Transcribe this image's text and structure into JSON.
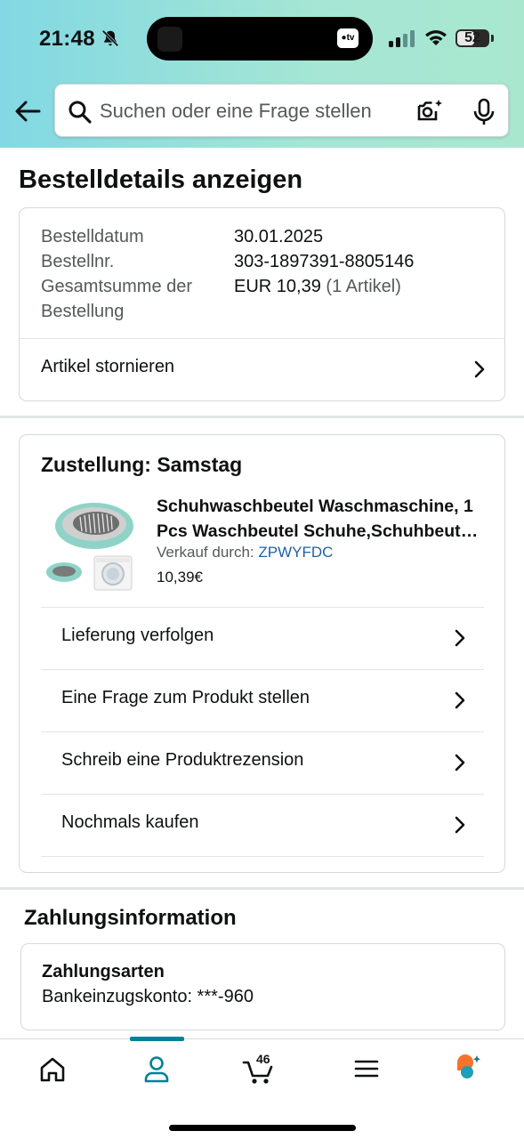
{
  "status_bar": {
    "time": "21:48",
    "battery": "52"
  },
  "search": {
    "placeholder": "Suchen oder eine Frage stellen"
  },
  "page": {
    "title": "Bestelldetails anzeigen"
  },
  "order_summary": {
    "date_label": "Bestelldatum",
    "date_value": "30.01.2025",
    "number_label": "Bestellnr.",
    "number_value": "303-1897391-8805146",
    "total_label_1": "Gesamtsumme der",
    "total_label_2": "Bestellung",
    "total_value": "EUR 10,39",
    "total_items": "(1 Artikel)",
    "cancel_label": "Artikel stornieren"
  },
  "delivery": {
    "title": "Zustellung: Samstag",
    "product": {
      "title_line1": "Schuhwaschbeutel Waschmaschine, 1",
      "title_line2": "Pcs Waschbeutel Schuhe,Schuhbeutel Waschmaschine",
      "seller_prefix": "Verkauf durch:",
      "seller_name": "ZPWYFDC",
      "price": "10,39€"
    },
    "actions": [
      {
        "label": "Lieferung verfolgen"
      },
      {
        "label": "Eine Frage zum Produkt stellen"
      },
      {
        "label": "Schreib eine Produktrezension"
      },
      {
        "label": "Nochmals kaufen"
      }
    ]
  },
  "payment": {
    "section_title": "Zahlungsinformation",
    "method_title": "Zahlungsarten",
    "method_value": "Bankeinzugskonto: ***-960"
  },
  "bottom_nav": {
    "cart_count": "46",
    "items": [
      "home-icon",
      "account-icon",
      "cart-icon",
      "menu-icon",
      "rufus-icon"
    ],
    "active": "account-icon",
    "accent_color": "#008296"
  },
  "colors": {
    "header_gradient_start": "#82d8e3",
    "header_gradient_end": "#a9e7cf",
    "link": "#2162a1"
  }
}
